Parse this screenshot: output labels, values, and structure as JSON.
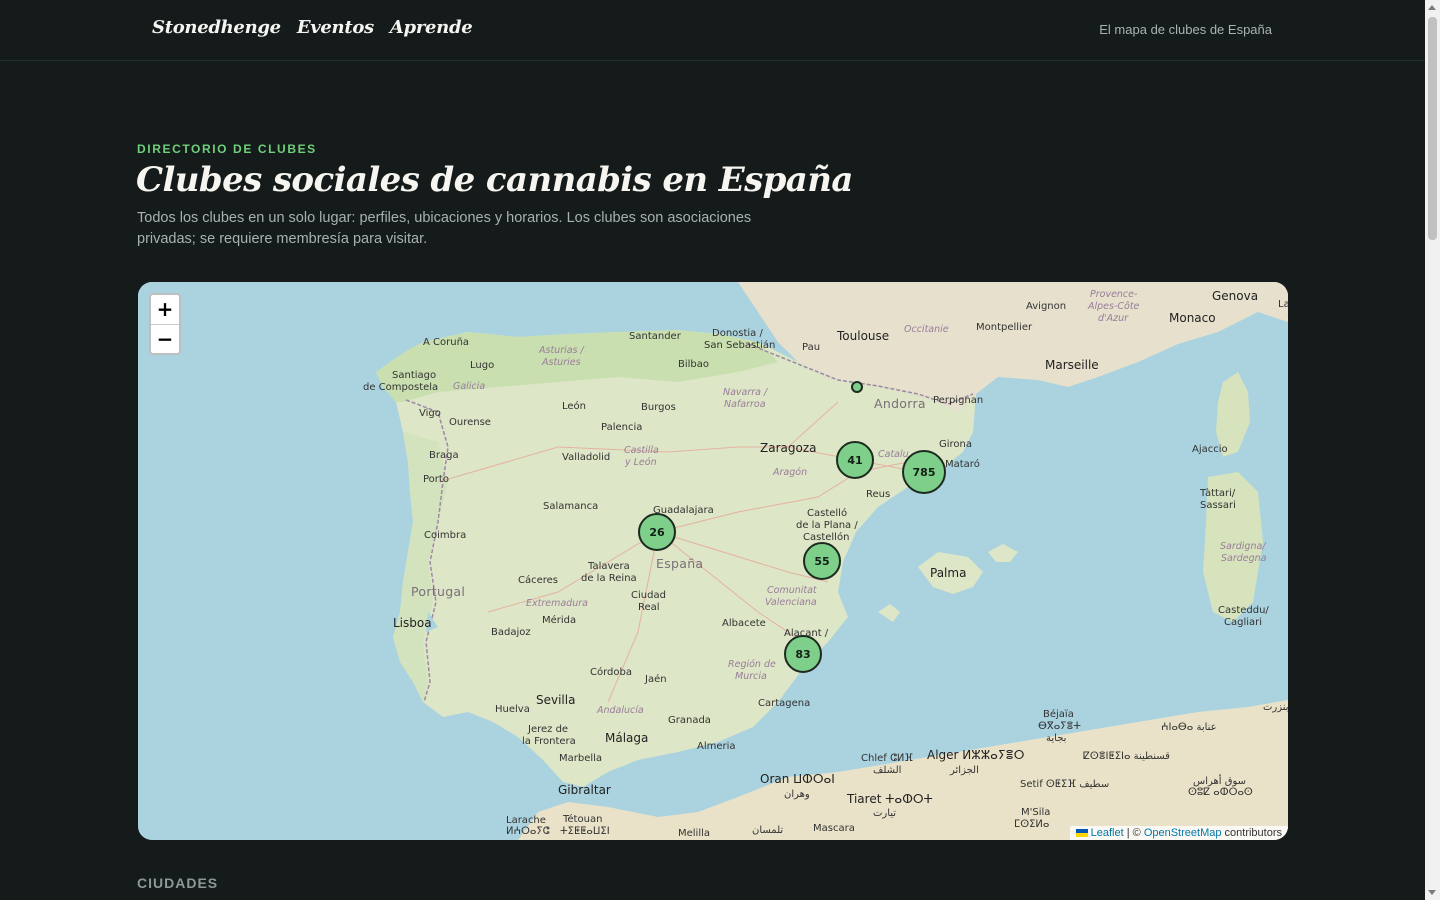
{
  "nav": {
    "links": [
      "Stonedhenge",
      "Eventos",
      "Aprende"
    ],
    "tagline": "El mapa de clubes de España"
  },
  "hero": {
    "eyebrow": "DIRECTORIO DE CLUBES",
    "title": "Clubes sociales de cannabis en España",
    "subtitle": "Todos los clubes en un solo lugar: perfiles, ubicaciones y horarios. Los clubes son asociaciones privadas; se requiere membresía para visitar."
  },
  "map": {
    "zoom_in": "+",
    "zoom_out": "−",
    "clusters": [
      {
        "name": "barcelona",
        "count": "785"
      },
      {
        "name": "lleida-tarragona",
        "count": "41"
      },
      {
        "name": "madrid",
        "count": "26"
      },
      {
        "name": "valencia",
        "count": "55"
      },
      {
        "name": "alicante",
        "count": "83"
      }
    ],
    "attribution": {
      "leaflet": "Leaflet",
      "separator": " | © ",
      "osm": "OpenStreetMap",
      "suffix": " contributors"
    },
    "labels": {
      "acoruna": "A Coruña",
      "lugo": "Lugo",
      "santiago": "Santiago",
      "santiago2": "de Compostela",
      "galicia": "Galicia",
      "vigo": "Vigo",
      "ourense": "Ourense",
      "braga": "Braga",
      "porto": "Porto",
      "coimbra": "Coimbra",
      "portugal": "Portugal",
      "lisboa": "Lisboa",
      "asturias": "Asturias /",
      "asturias2": "Asturies",
      "santander": "Santander",
      "donostia": "Donostia /",
      "donostia2": "San Sebastián",
      "bilbao": "Bilbao",
      "pau": "Pau",
      "toulouse": "Toulouse",
      "occitanie": "Occitanie",
      "montpellier": "Montpellier",
      "avignon": "Avignon",
      "provence": "Provence-",
      "provence2": "Alpes-Côte",
      "provence3": "d'Azur",
      "genova": "Genova",
      "monaco": "Monaco",
      "marseille": "Marseille",
      "navarra": "Navarra /",
      "navarra2": "Nafarroa",
      "leon": "León",
      "burgos": "Burgos",
      "palencia": "Palencia",
      "andorra": "Andorra",
      "perpignan": "Perpignan",
      "zaragoza": "Zaragoza",
      "aragon": "Aragón",
      "catalu": "Catalu",
      "girona": "Girona",
      "mataro": "Mataró",
      "reus": "Reus",
      "valladolid": "Valladolid",
      "castilla": "Castilla",
      "castilla2": "y León",
      "salamanca": "Salamanca",
      "guadalajara": "Guadalajara",
      "espana": "España",
      "talavera": "Talavera",
      "talavera2": "de la Reina",
      "caceres": "Cáceres",
      "extremadura": "Extremadura",
      "merida": "Mérida",
      "badajoz": "Badajoz",
      "castello": "Castelló",
      "castello2": "de la Plana /",
      "castello3": "Castellón",
      "palma": "Palma",
      "ajaccio": "Ajaccio",
      "tattari": "Tàttari/",
      "tattari2": "Sassari",
      "sardigna": "Sardigna/",
      "sardigna2": "Sardegna",
      "casteddu": "Casteddu/",
      "casteddu2": "Cagliari",
      "ciudadreal": "Ciudad",
      "ciudadreal2": "Real",
      "comunitat": "Comunitat",
      "comunitat2": "Valenciana",
      "albacete": "Albacete",
      "alacant": "Alacant /",
      "region": "Región de",
      "region2": "Murcia",
      "cordoba": "Córdoba",
      "jaen": "Jaén",
      "sevilla": "Sevilla",
      "huelva": "Huelva",
      "andalucia": "Andalucía",
      "granada": "Granada",
      "cartagena": "Cartagena",
      "jerez": "Jerez de",
      "jerez2": "la Frontera",
      "malaga": "Málaga",
      "almeria": "Almeria",
      "marbella": "Marbella",
      "gibraltar": "Gibraltar",
      "oran": "Oran ⵡⵀⵔⴰⵏ",
      "oran2": "وهران",
      "chlef": "Chlef ⵛⵍⴼ",
      "chlef2": "الشلف",
      "alger": "Alger ⵍⵣⵣⴰⵢⴻⵔ",
      "alger2": "الجزائر",
      "tiaret": "Tiaret ⵜⴰⵀⵔⵜ",
      "tiaret2": "تيارت",
      "bejaia": "Béjaïa",
      "bejaia2": "ⴱⴳⴰⵢⴻⵜ",
      "bejaia3": "بجاية",
      "annaba": "ⵄⵏⴰⴱⴰ عنابة",
      "constantine": "ⵇⵙⴻⵏⵟⵉⵏⴰ قسنطينة",
      "setif": "Setif ⵙⵟⵉⴼ سطيف",
      "souk": "سوق أهراس",
      "souk2": "ⵙⵓⵇ ⴰⵀⵔⴰⵙ",
      "msila": "M'Sila",
      "msila2": "ⵎⵙⵉⵍⴰ",
      "larache": "Larache",
      "larache2": "ⵍⵄⵔⴰⵢⵛ",
      "tetouan": "Tétouan",
      "tetouan2": "ⵜⵉⵟⵟⴰⵡⵉⵏ",
      "melilla": "Melilla",
      "tlemcen": "تلمسان",
      "mascara": "Mascara",
      "bizerte": "بنزرت",
      "la": "La"
    }
  },
  "sections": {
    "ciudades": "CIUDADES"
  }
}
